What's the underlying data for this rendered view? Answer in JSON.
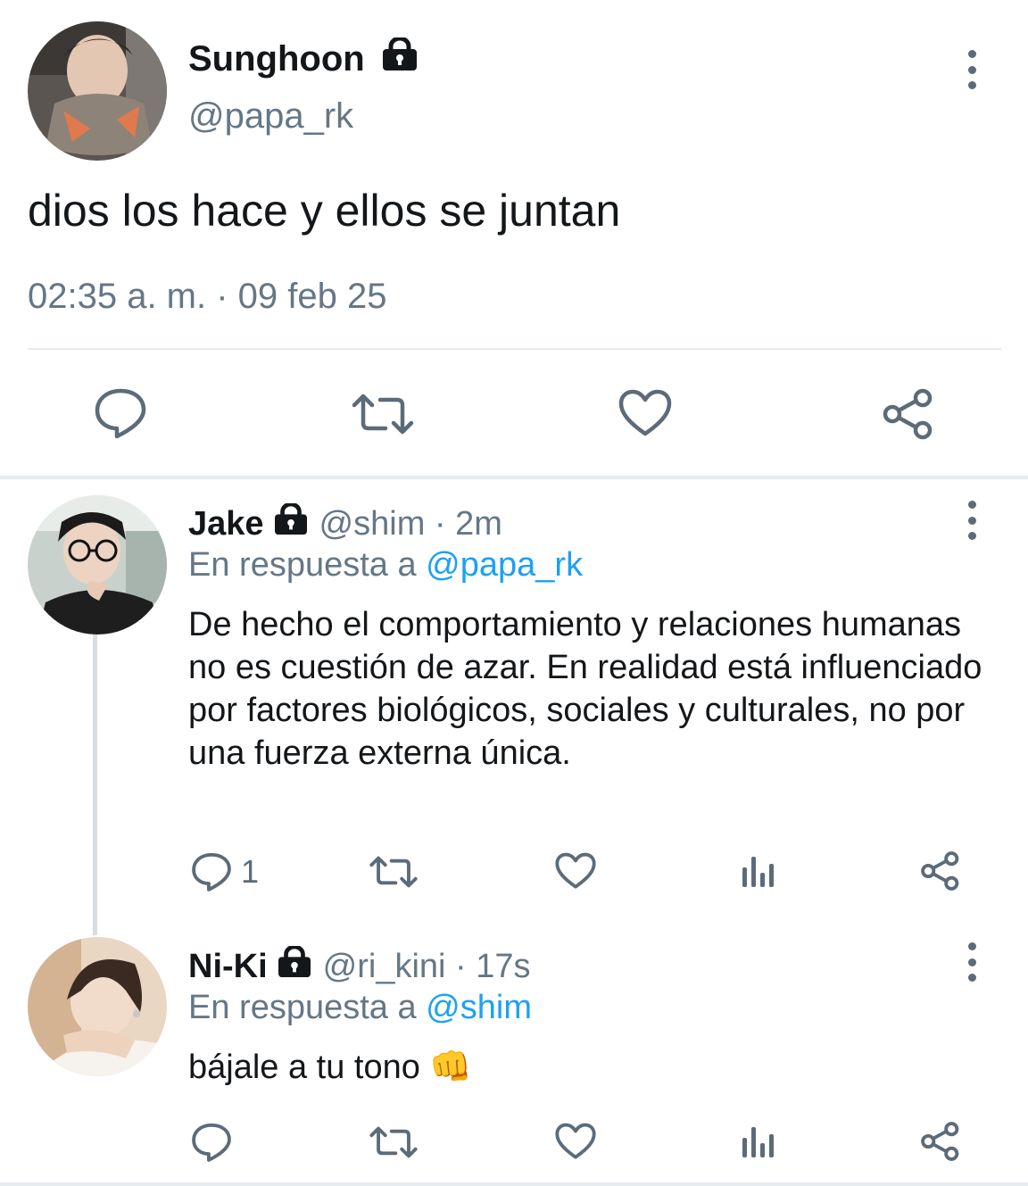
{
  "main_tweet": {
    "name": "Sunghoon",
    "handle": "@papa_rk",
    "text": "dios los hace y ellos se juntan",
    "timestamp": "02:35 a. m. · 09 feb 25",
    "avatar_icon": "avatar-photo-scarf",
    "actions": [
      {
        "icon": "reply-icon"
      },
      {
        "icon": "retweet-icon"
      },
      {
        "icon": "like-icon"
      },
      {
        "icon": "share-icon"
      }
    ]
  },
  "replies": [
    {
      "name": "Jake",
      "handle": "@shim · 2m",
      "reply_prefix": "En respuesta a ",
      "reply_mention": "@papa_rk",
      "text": "De hecho el comportamiento y relaciones humanas no es cuestión de azar. En realidad está influenciado por factores biológicos, sociales y culturales, no por una fuerza externa única.",
      "reply_count": "1"
    },
    {
      "name": "Ni-Ki",
      "handle": "@ri_kini · 17s",
      "reply_prefix": "En respuesta a ",
      "reply_mention": "@shim",
      "text": "bájale a tu tono 👊",
      "reply_count": ""
    }
  ],
  "colors": {
    "text": "#14171a",
    "secondary": "#657786",
    "link": "#1da1f2",
    "icon": "#5b6b79",
    "divider": "#e6ecf0"
  }
}
